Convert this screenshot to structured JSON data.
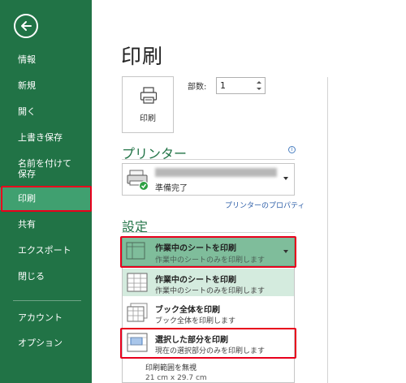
{
  "sidebar": {
    "items": [
      {
        "label": "情報"
      },
      {
        "label": "新規"
      },
      {
        "label": "開く"
      },
      {
        "label": "上書き保存"
      },
      {
        "label": "名前を付けて\n保存"
      },
      {
        "label": "印刷"
      },
      {
        "label": "共有"
      },
      {
        "label": "エクスポート"
      },
      {
        "label": "閉じる"
      },
      {
        "label": "アカウント"
      },
      {
        "label": "オプション"
      }
    ]
  },
  "main": {
    "title": "印刷",
    "print_button_label": "印刷",
    "copies_label": "部数:",
    "copies_value": "1",
    "printer_heading": "プリンター",
    "printer_status": "準備完了",
    "printer_properties_link": "プリンターのプロパティ",
    "settings_heading": "設定",
    "selected_setting": {
      "title": "作業中のシートを印刷",
      "subtitle": "作業中のシートのみを印刷します"
    },
    "options": [
      {
        "title": "作業中のシートを印刷",
        "subtitle": "作業中のシートのみを印刷します"
      },
      {
        "title": "ブック全体を印刷",
        "subtitle": "ブック全体を印刷します"
      },
      {
        "title": "選択した部分を印刷",
        "subtitle": "現在の選択部分のみを印刷します"
      }
    ],
    "ignore_print_area": "印刷範囲を無視",
    "paper_size": "21 cm x 29.7 cm"
  },
  "colors": {
    "sidebar_bg": "#217346",
    "active_item": "#40a070",
    "highlight_red": "#e8001c",
    "accent_green": "#217346"
  }
}
